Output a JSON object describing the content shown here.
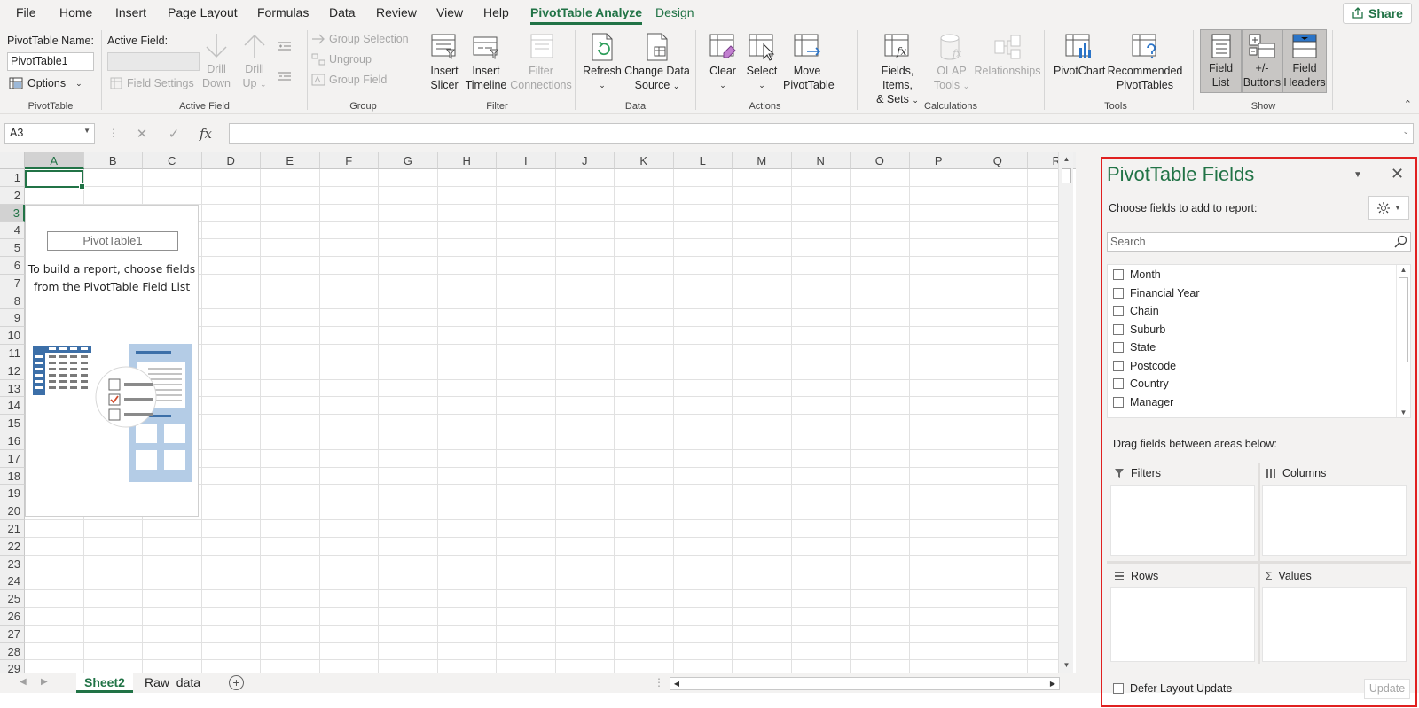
{
  "menu": {
    "tabs": [
      "File",
      "Home",
      "Insert",
      "Page Layout",
      "Formulas",
      "Data",
      "Review",
      "View",
      "Help",
      "PivotTable Analyze",
      "Design"
    ],
    "share_label": "Share"
  },
  "ribbon": {
    "pivottable": {
      "name_label": "PivotTable Name:",
      "name_value": "PivotTable1",
      "options_label": "Options",
      "group_label": "PivotTable"
    },
    "active_field": {
      "label": "Active Field:",
      "field_settings": "Field Settings",
      "drill_down": [
        "Drill",
        "Down"
      ],
      "drill_up": [
        "Drill",
        "Up"
      ],
      "group_label": "Active Field"
    },
    "group": {
      "group_selection": "Group Selection",
      "ungroup": "Ungroup",
      "group_field": "Group Field",
      "group_label": "Group"
    },
    "filter": {
      "insert_slicer": [
        "Insert",
        "Slicer"
      ],
      "insert_timeline": [
        "Insert",
        "Timeline"
      ],
      "filter_connections": [
        "Filter",
        "Connections"
      ],
      "group_label": "Filter"
    },
    "data": {
      "refresh": "Refresh",
      "change_source": [
        "Change Data",
        "Source"
      ],
      "group_label": "Data"
    },
    "actions": {
      "clear": "Clear",
      "select": "Select",
      "move": [
        "Move",
        "PivotTable"
      ],
      "group_label": "Actions"
    },
    "calculations": {
      "fields_items": [
        "Fields, Items,",
        "& Sets"
      ],
      "olap_tools": [
        "OLAP",
        "Tools"
      ],
      "relationships": "Relationships",
      "group_label": "Calculations"
    },
    "tools": {
      "pivotchart": "PivotChart",
      "recommended": [
        "Recommended",
        "PivotTables"
      ],
      "group_label": "Tools"
    },
    "show": {
      "field_list": [
        "Field",
        "List"
      ],
      "buttons": [
        "+/-",
        "Buttons"
      ],
      "field_headers": [
        "Field",
        "Headers"
      ],
      "group_label": "Show"
    }
  },
  "formula_bar": {
    "name_box": "A3",
    "fx_label": "fx",
    "value": ""
  },
  "grid": {
    "columns": [
      "A",
      "B",
      "C",
      "D",
      "E",
      "F",
      "G",
      "H",
      "I",
      "J",
      "K",
      "L",
      "M",
      "N",
      "O",
      "P",
      "Q",
      "R"
    ],
    "rows": [
      "1",
      "2",
      "3",
      "4",
      "5",
      "6",
      "7",
      "8",
      "9",
      "10",
      "11",
      "12",
      "13",
      "14",
      "15",
      "16",
      "17",
      "18",
      "19",
      "20",
      "21",
      "22",
      "23",
      "24",
      "25",
      "26",
      "27",
      "28",
      "29"
    ],
    "placeholder": {
      "title": "PivotTable1",
      "line1": "To build a report, choose fields",
      "line2": "from the PivotTable Field List"
    }
  },
  "sheets": {
    "tabs": [
      "Sheet2",
      "Raw_data"
    ],
    "active": "Sheet2"
  },
  "pane": {
    "title": "PivotTable Fields",
    "subtitle": "Choose fields to add to report:",
    "search_placeholder": "Search",
    "fields": [
      "Month",
      "Financial Year",
      "Chain",
      "Suburb",
      "State",
      "Postcode",
      "Country",
      "Manager"
    ],
    "drag_label": "Drag fields between areas below:",
    "areas": {
      "filters": "Filters",
      "columns": "Columns",
      "rows": "Rows",
      "values": "Values"
    },
    "defer_label": "Defer Layout Update",
    "update_label": "Update"
  },
  "colors": {
    "accent": "#217346",
    "highlight_outline": "#e02020"
  }
}
